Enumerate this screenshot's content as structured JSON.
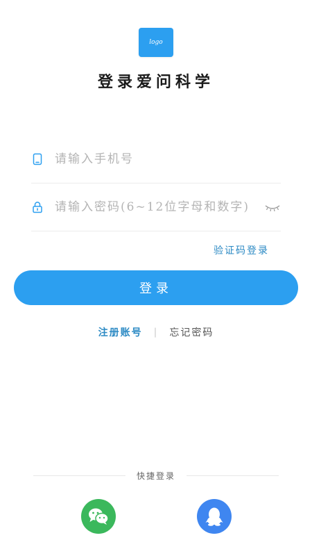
{
  "logo": {
    "text": "logo"
  },
  "title": "登录爱问科学",
  "phone_field": {
    "placeholder": "请输入手机号",
    "icon": "phone-icon"
  },
  "password_field": {
    "placeholder": "请输入密码(6~12位字母和数字)",
    "icon": "lock-icon",
    "toggle_icon": "eye-closed-icon"
  },
  "sms_login_link": "验证码登录",
  "login_button": "登录",
  "links": {
    "register": "注册账号",
    "separator": "|",
    "forgot": "忘记密码"
  },
  "quick_login": {
    "label": "快捷登录",
    "providers": [
      {
        "name": "wechat-icon"
      },
      {
        "name": "qq-icon"
      }
    ]
  },
  "colors": {
    "brand_blue": "#2c9ff0",
    "link_blue": "#2c8ac4",
    "wechat_green": "#3bb85c",
    "qq_blue": "#3f86f0"
  }
}
